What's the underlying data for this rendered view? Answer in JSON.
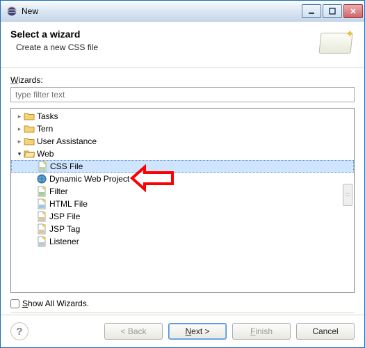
{
  "window": {
    "title": "New"
  },
  "header": {
    "title": "Select a wizard",
    "subtitle": "Create a new CSS file"
  },
  "filter": {
    "label_pre": "W",
    "label_post": "izards:",
    "placeholder": "type filter text"
  },
  "tree": [
    {
      "label": "Tasks",
      "expanded": false,
      "level": 0,
      "icon": "folder"
    },
    {
      "label": "Tern",
      "expanded": false,
      "level": 0,
      "icon": "folder"
    },
    {
      "label": "User Assistance",
      "expanded": false,
      "level": 0,
      "icon": "folder"
    },
    {
      "label": "Web",
      "expanded": true,
      "level": 0,
      "icon": "folder-open"
    },
    {
      "label": "CSS File",
      "level": 1,
      "icon": "css",
      "selected": true
    },
    {
      "label": "Dynamic Web Project",
      "level": 1,
      "icon": "globe"
    },
    {
      "label": "Filter",
      "level": 1,
      "icon": "filter"
    },
    {
      "label": "HTML File",
      "level": 1,
      "icon": "html"
    },
    {
      "label": "JSP File",
      "level": 1,
      "icon": "jsp"
    },
    {
      "label": "JSP Tag",
      "level": 1,
      "icon": "jsptag"
    },
    {
      "label": "Listener",
      "level": 1,
      "icon": "listener"
    }
  ],
  "showAll": {
    "label_pre": "S",
    "label_post": "how All Wizards.",
    "checked": false
  },
  "buttons": {
    "back": "< Back",
    "next": "Next >",
    "finish": "Finish",
    "cancel": "Cancel"
  }
}
